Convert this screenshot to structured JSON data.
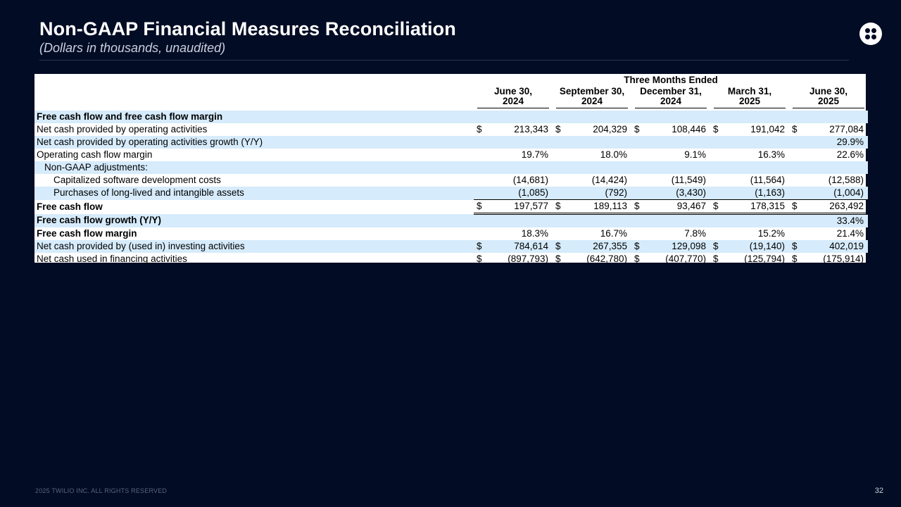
{
  "header": {
    "title": "Non-GAAP Financial Measures Reconciliation",
    "subtitle": "(Dollars in thousands, unaudited)"
  },
  "logo": {
    "icon": "twilio-logo-icon"
  },
  "table": {
    "group_header": "Three Months Ended",
    "periods": [
      {
        "month": "June 30,",
        "year": "2024"
      },
      {
        "month": "September 30,",
        "year": "2024"
      },
      {
        "month": "December 31,",
        "year": "2024"
      },
      {
        "month": "March 31,",
        "year": "2025"
      },
      {
        "month": "June 30,",
        "year": "2025"
      }
    ],
    "rows": [
      {
        "label": "Free cash flow and free cash flow margin",
        "bold": true,
        "shade": true,
        "indent": 0,
        "sign": false,
        "values": [
          "",
          "",
          "",
          "",
          ""
        ]
      },
      {
        "label": "Net cash provided by operating activities",
        "bold": false,
        "shade": false,
        "indent": 0,
        "sign": true,
        "values": [
          "213,343",
          "204,329",
          "108,446",
          "191,042",
          "277,084"
        ]
      },
      {
        "label": "Net cash provided by operating activities growth (Y/Y)",
        "bold": false,
        "shade": true,
        "indent": 0,
        "sign": false,
        "values": [
          "",
          "",
          "",
          "",
          "29.9%"
        ]
      },
      {
        "label": "Operating cash flow margin",
        "bold": false,
        "shade": false,
        "indent": 0,
        "sign": false,
        "values": [
          "19.7%",
          "18.0%",
          "9.1%",
          "16.3%",
          "22.6%"
        ]
      },
      {
        "label": "Non-GAAP adjustments:",
        "bold": false,
        "shade": true,
        "indent": 1,
        "sign": false,
        "values": [
          "",
          "",
          "",
          "",
          ""
        ]
      },
      {
        "label": "Capitalized software development costs",
        "bold": false,
        "shade": false,
        "indent": 2,
        "sign": false,
        "values": [
          "(14,681)",
          "(14,424)",
          "(11,549)",
          "(11,564)",
          "(12,588)"
        ]
      },
      {
        "label": "Purchases of long-lived and intangible assets",
        "bold": false,
        "shade": true,
        "indent": 2,
        "sign": false,
        "values": [
          "(1,085)",
          "(792)",
          "(3,430)",
          "(1,163)",
          "(1,004)"
        ]
      },
      {
        "label": "Free cash flow",
        "bold": true,
        "shade": false,
        "indent": 0,
        "sign": true,
        "values": [
          "197,577",
          "189,113",
          "93,467",
          "178,315",
          "263,492"
        ]
      },
      {
        "label": "Free cash flow growth (Y/Y)",
        "bold": true,
        "shade": true,
        "indent": 0,
        "sign": false,
        "values": [
          "",
          "",
          "",
          "",
          "33.4%"
        ]
      },
      {
        "label": "Free cash flow margin",
        "bold": true,
        "shade": false,
        "indent": 0,
        "sign": false,
        "values": [
          "18.3%",
          "16.7%",
          "7.8%",
          "15.2%",
          "21.4%"
        ]
      },
      {
        "label": "Net cash provided by (used in) investing activities",
        "bold": false,
        "shade": true,
        "indent": 0,
        "sign": true,
        "values": [
          "784,614",
          "267,355",
          "129,098",
          "(19,140)",
          "402,019"
        ]
      },
      {
        "label": "Net cash used in financing activities",
        "bold": false,
        "shade": false,
        "indent": 0,
        "sign": true,
        "values": [
          "(897,793)",
          "(642,780)",
          "(407,770)",
          "(125,794)",
          "(175,914)"
        ]
      }
    ],
    "currency_symbol": "$"
  },
  "footer": {
    "copyright": "2025 TWILIO INC. ALL RIGHTS RESERVED",
    "page_number": "32"
  },
  "colors": {
    "background": "#020c24",
    "row_shade": "#d6ebfb",
    "title": "#ffffff"
  }
}
